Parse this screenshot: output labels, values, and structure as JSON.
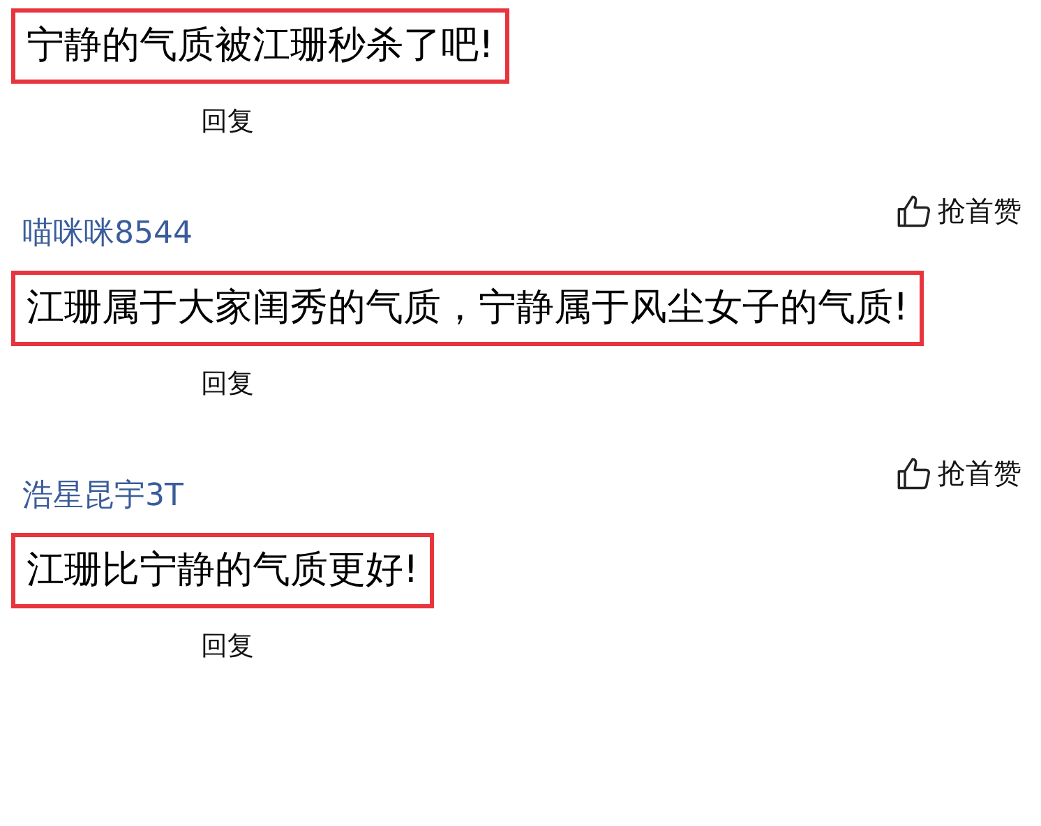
{
  "comments": [
    {
      "text": "宁静的气质被江珊秒杀了吧!",
      "highlighted": true,
      "reply": "回复"
    },
    {
      "user": "喵咪咪8544",
      "like": "抢首赞",
      "text": "江珊属于大家闺秀的气质，宁静属于风尘女子的气质!",
      "highlighted": true,
      "reply": "回复"
    },
    {
      "user": "浩星昆宇3T",
      "like": "抢首赞",
      "text": "江珊比宁静的气质更好!",
      "highlighted": true,
      "reply": "回复"
    }
  ]
}
